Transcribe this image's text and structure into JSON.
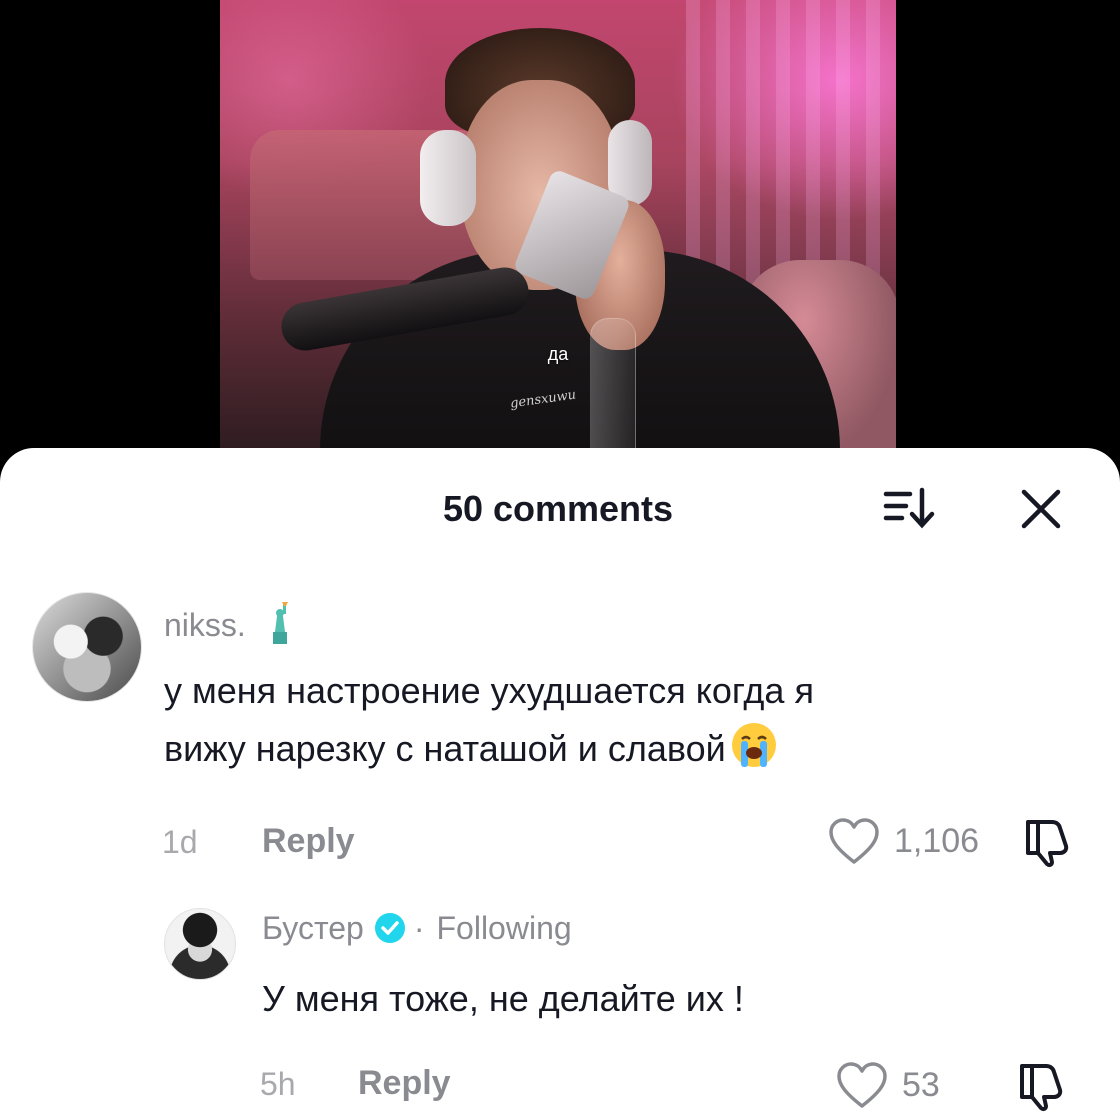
{
  "video": {
    "subtitle": "да",
    "watermark": "gensxuwu"
  },
  "comments_panel": {
    "title": "50 comments",
    "sort_icon": "sort-icon",
    "close_icon": "close-icon"
  },
  "comments": [
    {
      "username": "nikss.",
      "username_emoji": "statue-of-liberty",
      "text_line1": "у меня настроение ухудшается когда я",
      "text_line2": "вижу нарезку с наташой и славой",
      "text_emoji": "loudly-crying-face",
      "time": "1d",
      "reply_label": "Reply",
      "likes": "1,106"
    },
    {
      "username": "Бустер",
      "verified": true,
      "separator": "·",
      "status": "Following",
      "text": "У меня тоже, не делайте их !",
      "time": "5h",
      "reply_label": "Reply",
      "likes": "53"
    }
  ],
  "colors": {
    "primary_text": "#161823",
    "secondary_text": "#8a8b91",
    "verified_blue": "#20d5ec",
    "sheet_background": "#ffffff"
  }
}
